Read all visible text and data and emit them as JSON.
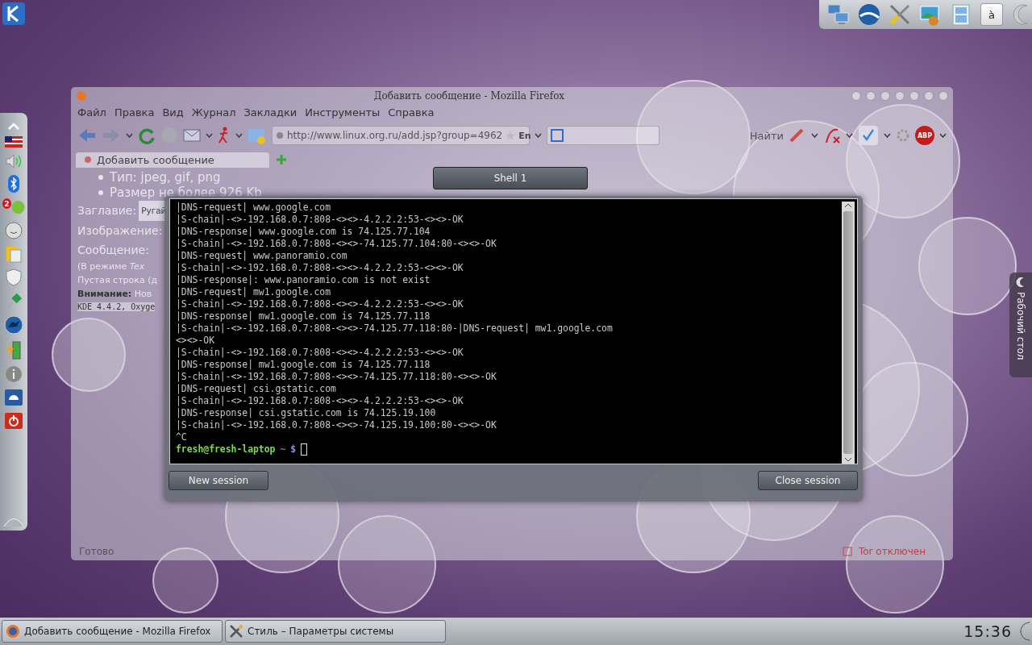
{
  "top_panel": {
    "keyboard_key": "à"
  },
  "left_panel": {
    "messenger_badge": "2"
  },
  "firefox": {
    "title": "Добавить сообщение - Mozilla Firefox",
    "menu": [
      "Файл",
      "Правка",
      "Вид",
      "Журнал",
      "Закладки",
      "Инструменты",
      "Справка"
    ],
    "url": "http://www.linux.org.ru/add.jsp?group=4962",
    "input_language": "En",
    "search_button": "Найти",
    "adblock_label": "ABP",
    "tabs": [
      {
        "label": "Добавить сообщение",
        "selected": true
      }
    ],
    "content": {
      "bullets": [
        "Тип: jpeg, gif, png",
        "Размер не более 926 Kb"
      ],
      "fields": [
        {
          "label": "Заглавие:",
          "value": "Ругай"
        },
        {
          "label": "Изображение:"
        },
        {
          "label": "Сообщение:"
        }
      ],
      "notes": [
        "(В режиме *Tex*",
        "Пустая строка (д",
        "**Внимание:** Нов"
      ],
      "message_value": "KDE 4.4.2, Oxyge"
    },
    "status": "Готово",
    "tor_status": "Tor отключен"
  },
  "terminal": {
    "tab": "Shell 1",
    "lines": [
      "|DNS-request| www.google.com",
      "|S-chain|-<>-192.168.0.7:808-<><>-4.2.2.2:53-<><>-OK",
      "|DNS-response| www.google.com is 74.125.77.104",
      "|S-chain|-<>-192.168.0.7:808-<><>-74.125.77.104:80-<><>-OK",
      "|DNS-request| www.panoramio.com",
      "|S-chain|-<>-192.168.0.7:808-<><>-4.2.2.2:53-<><>-OK",
      "|DNS-response|: www.panoramio.com is not exist",
      "|DNS-request| mw1.google.com",
      "|S-chain|-<>-192.168.0.7:808-<><>-4.2.2.2:53-<><>-OK",
      "|DNS-response| mw1.google.com is 74.125.77.118",
      "|S-chain|-<>-192.168.0.7:808-<><>-74.125.77.118:80-|DNS-request| mw1.google.com",
      "<><>-OK",
      "|S-chain|-<>-192.168.0.7:808-<><>-4.2.2.2:53-<><>-OK",
      "|DNS-response| mw1.google.com is 74.125.77.118",
      "|S-chain|-<>-192.168.0.7:808-<><>-74.125.77.118:80-<><>-OK",
      "|DNS-request| csi.gstatic.com",
      "|S-chain|-<>-192.168.0.7:808-<><>-4.2.2.2:53-<><>-OK",
      "|DNS-response| csi.gstatic.com is 74.125.19.100",
      "|S-chain|-<>-192.168.0.7:808-<><>-74.125.19.100:80-<><>-OK",
      "^C"
    ],
    "prompt": {
      "user_host": "fresh@fresh-laptop",
      "path": "~",
      "symbol": "$"
    },
    "buttons": [
      "New session",
      "Close session"
    ]
  },
  "desktop_tab": "Рабочий стол",
  "taskbar": {
    "tasks": [
      "Добавить сообщение - Mozilla Firefox",
      "Стиль – Параметры системы"
    ],
    "clock": "15:36"
  }
}
